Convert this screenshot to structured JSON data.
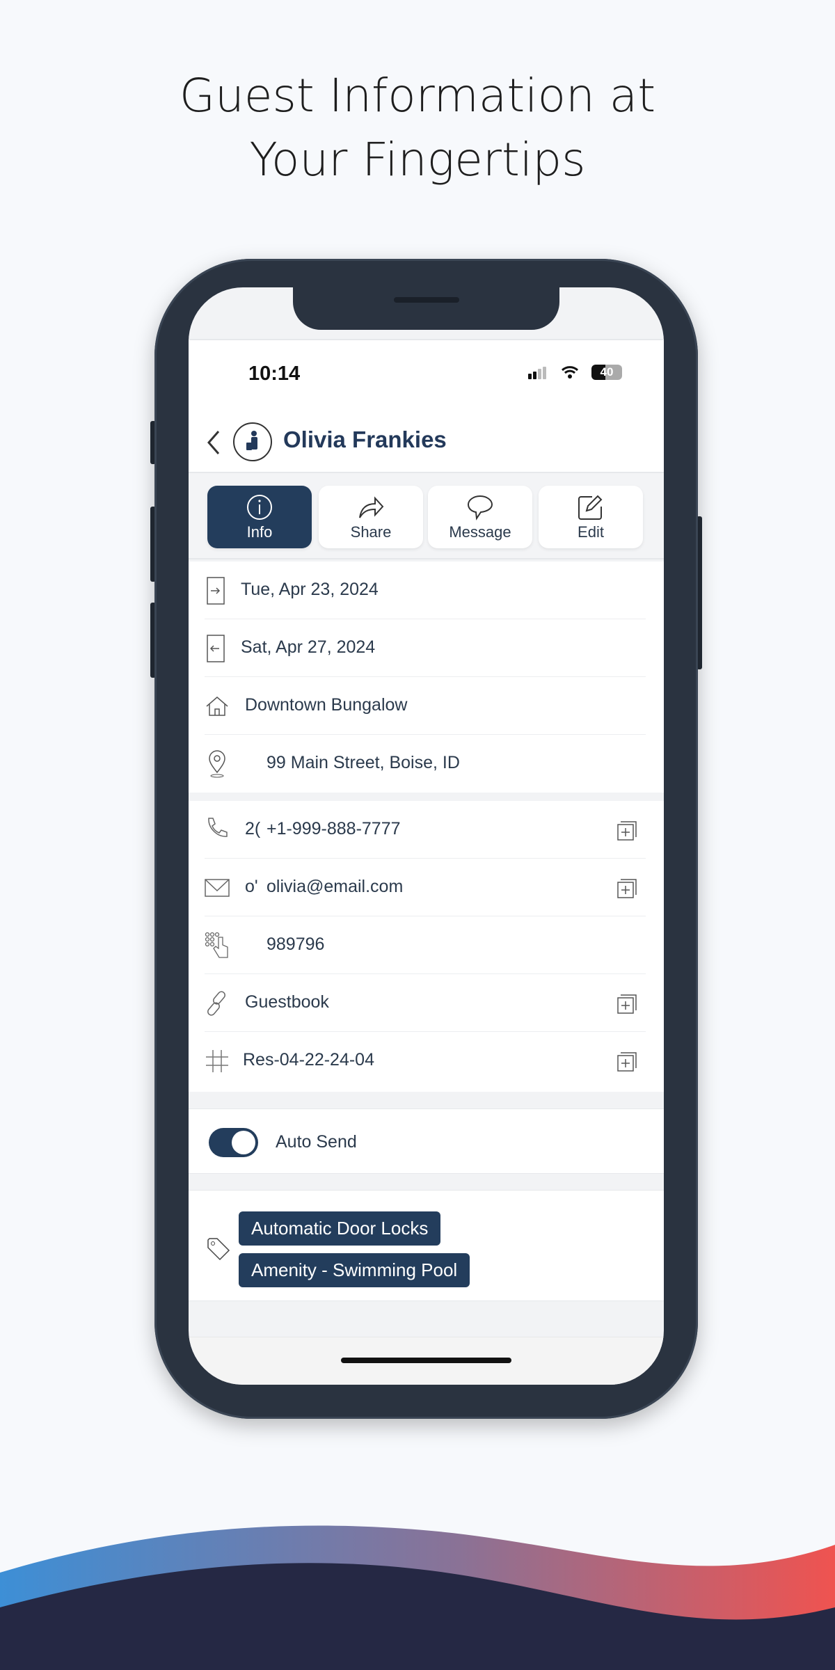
{
  "headline": {
    "line1": "Guest Information at",
    "line2": "Your Fingertips"
  },
  "status_bar": {
    "time": "10:14",
    "battery": "40"
  },
  "header": {
    "guest_name": "Olivia Frankies"
  },
  "tabs": [
    {
      "label": "Info",
      "icon": "info-icon",
      "active": true
    },
    {
      "label": "Share",
      "icon": "share-icon"
    },
    {
      "label": "Message",
      "icon": "message-icon"
    },
    {
      "label": "Edit",
      "icon": "edit-icon"
    }
  ],
  "stay": {
    "check_in": "Tue, Apr 23, 2024",
    "check_out": "Sat, Apr 27, 2024",
    "property": "Downtown Bungalow",
    "address": "99 Main Street, Boise, ID"
  },
  "contact": {
    "phone_prefix": "2(",
    "phone": "+1-999-888-7777",
    "email_prefix": "o'",
    "email": "olivia@email.com",
    "door_code": "989796",
    "guestbook": "Guestbook",
    "reservation": "Res-04-22-24-04"
  },
  "auto_send": {
    "label": "Auto Send",
    "enabled": true
  },
  "tags": [
    "Automatic Door Locks",
    "Amenity - Swimming Pool"
  ],
  "colors": {
    "accent": "#233d5c",
    "wave_left": "#3d8fd6",
    "wave_right": "#ef5350",
    "wave_dark": "#252844"
  }
}
